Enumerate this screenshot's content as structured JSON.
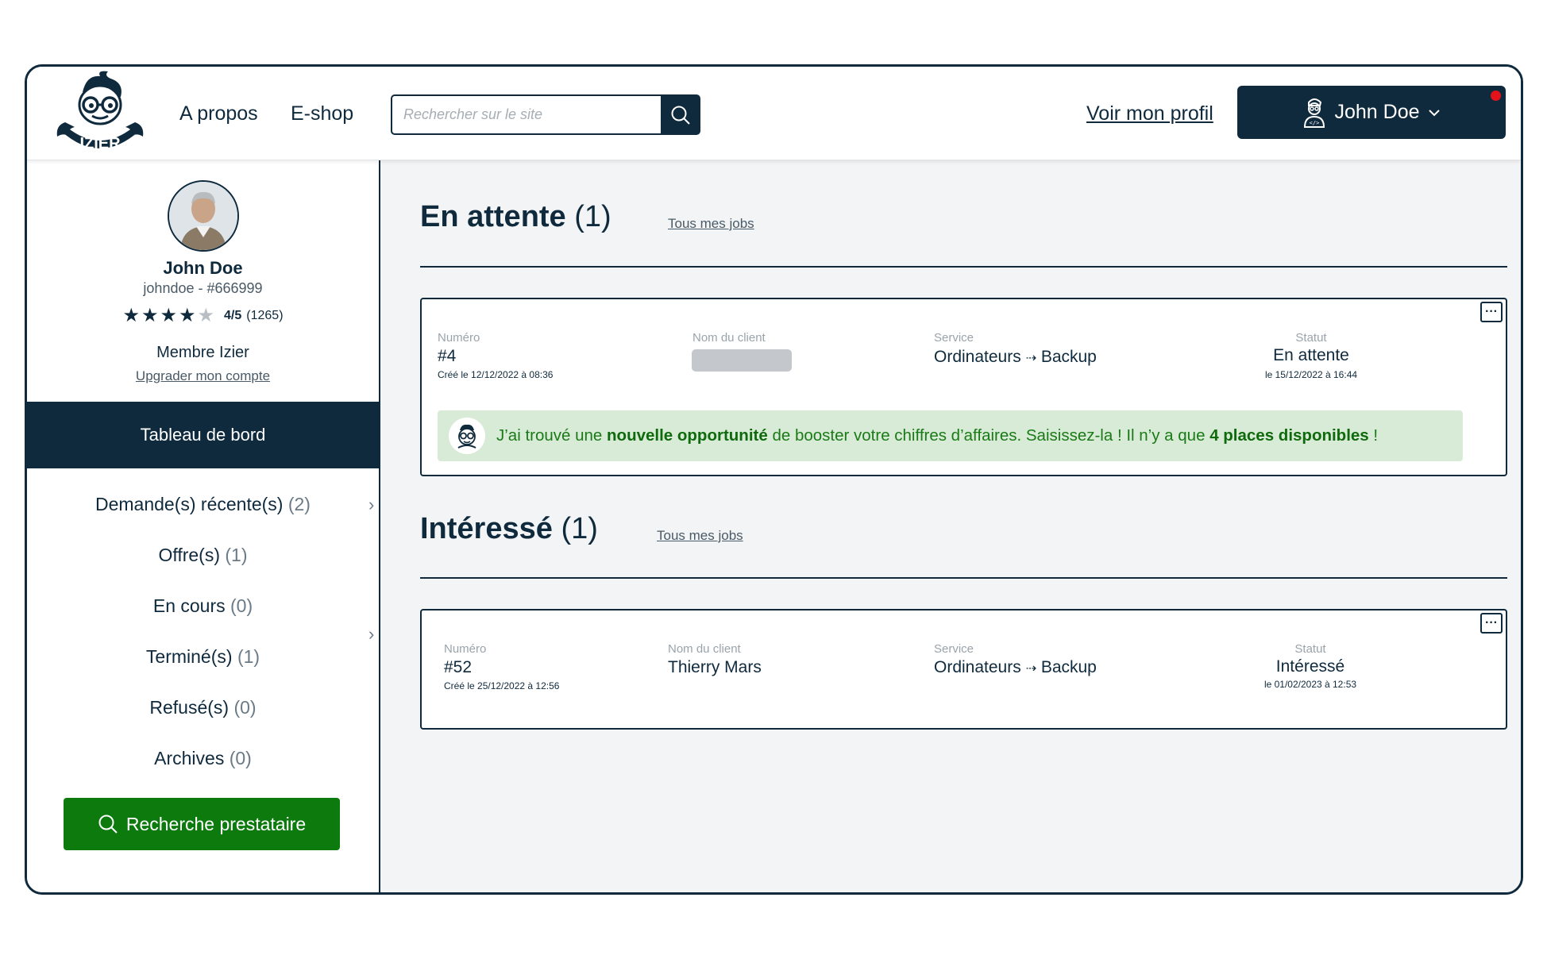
{
  "header": {
    "logo_text": "IZIER",
    "nav": [
      {
        "label": "A propos"
      },
      {
        "label": "E-shop"
      }
    ],
    "search": {
      "placeholder": "Rechercher sur le site",
      "value": ""
    },
    "profile_link": "Voir mon profil",
    "user_button": {
      "name": "John Doe",
      "has_notification": true
    }
  },
  "sidebar": {
    "name": "John Doe",
    "handle": "johndoe - #666999",
    "rating": {
      "stars_filled": 4,
      "stars_total": 5,
      "score": "4/5",
      "count": "(1265)"
    },
    "membership": "Membre Izier",
    "upgrade_link": "Upgrader mon compte",
    "dashboard_button": "Tableau de bord",
    "items": [
      {
        "label": "Demande(s) récente(s)",
        "count": "(2)"
      },
      {
        "label": "Offre(s)",
        "count": "(1)"
      },
      {
        "label": "En cours",
        "count": "(0)"
      },
      {
        "label": "Terminé(s)",
        "count": "(1)"
      },
      {
        "label": "Refusé(s)",
        "count": "(0)"
      },
      {
        "label": "Archives",
        "count": "(0)"
      }
    ],
    "search_button": "Recherche prestataire"
  },
  "main": {
    "sections": [
      {
        "title": "En attente",
        "count": "(1)",
        "link": "Tous mes jobs",
        "job": {
          "number_label": "Numéro",
          "number": "#4",
          "created": "Créé le 12/12/2022 à 08:36",
          "client_label": "Nom du client",
          "client": "",
          "service_label": "Service",
          "service_from": "Ordinateurs",
          "service_arrow": "⇢",
          "service_to": "Backup",
          "status_label": "Statut",
          "status": "En attente",
          "status_date": "le 15/12/2022 à 16:44"
        },
        "banner": {
          "part1": "J’ai trouvé une ",
          "bold1": "nouvelle opportunité",
          "part2": " de booster votre chiffres d’affaires. Saisissez-la ! Il n’y a que ",
          "bold2": "4 places disponibles",
          "part3": " !"
        }
      },
      {
        "title": "Intéressé",
        "count": "(1)",
        "link": "Tous mes jobs",
        "job": {
          "number_label": "Numéro",
          "number": "#52",
          "created": "Créé le 25/12/2022 à 12:56",
          "client_label": "Nom du client",
          "client": "Thierry Mars",
          "service_label": "Service",
          "service_from": "Ordinateurs",
          "service_arrow": "⇢",
          "service_to": "Backup",
          "status_label": "Statut",
          "status": "Intéressé",
          "status_date": "le 01/02/2023 à 12:53"
        }
      }
    ]
  },
  "colors": {
    "primary": "#0f2a3d",
    "accent_green": "#0d7a0e",
    "banner_bg": "#d8ebd6",
    "notification": "#e3121b"
  }
}
